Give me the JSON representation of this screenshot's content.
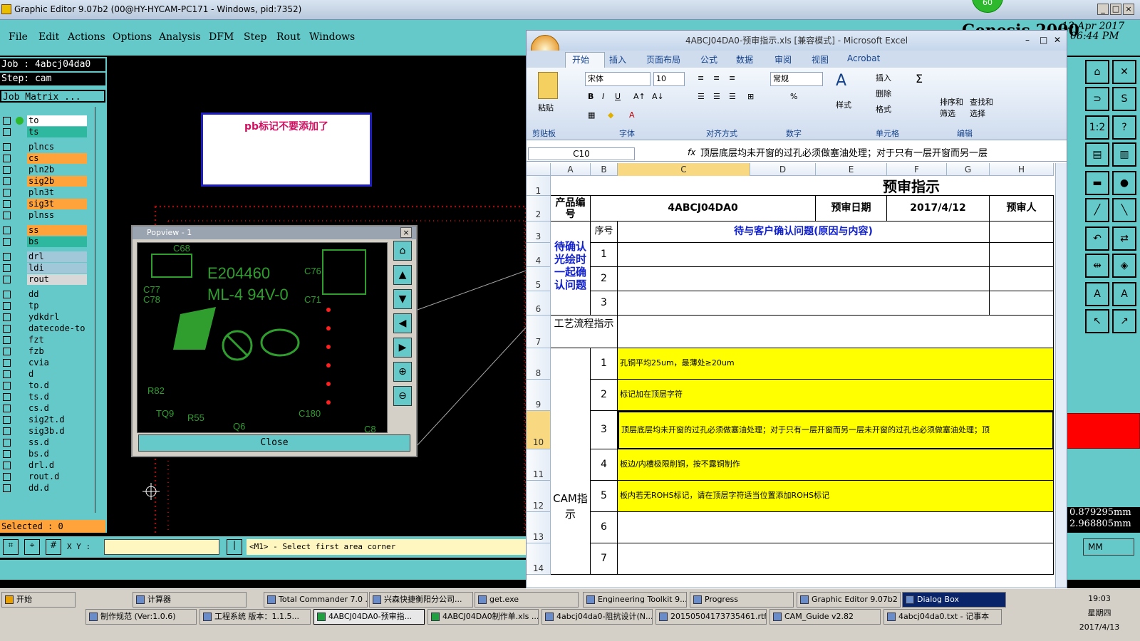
{
  "genesis": {
    "title": "Graphic Editor 9.07b2 (00@HY-HYCAM-PC171 - Windows, pid:7352)",
    "menu": [
      "File",
      "Edit",
      "Actions",
      "Options",
      "Analysis",
      "DFM",
      "Step",
      "Rout",
      "Windows"
    ],
    "badge": "60",
    "logo": "Genesis 2000",
    "date": "13 Apr 2017",
    "time": "06:44 PM",
    "job_label": "Job : 4abcj04da0",
    "step_label": "Step: cam",
    "job_matrix": "Job Matrix ...",
    "layers": [
      "to",
      "ts",
      "plncs",
      "cs",
      "pln2b",
      "sig2b",
      "pln3t",
      "sig3t",
      "plnss",
      "ss",
      "bs",
      "drl",
      "ldi",
      "rout",
      "dd",
      "tp",
      "ydkdrl",
      "datecode-to",
      "fzt",
      "fzb",
      "cvia",
      "d",
      "to.d",
      "ts.d",
      "cs.d",
      "sig2t.d",
      "sig3b.d",
      "ss.d",
      "bs.d",
      "drl.d",
      "rout.d",
      "dd.d"
    ],
    "selected": "Selected : 0",
    "xy_label": "X Y :",
    "cmd_message": "<M1> - Select first area corner",
    "note_text": "pb标记不要添加了",
    "coords": [
      "0.879295mm",
      "2.968805mm"
    ],
    "units": "MM",
    "popview": {
      "title": "Popview - 1",
      "close": "Close",
      "silk": [
        "C68",
        "E204460",
        "C76",
        "ML-4 94V-0",
        "C77",
        "C78",
        "C71",
        "R82",
        "TQ9",
        "R55",
        "Q6",
        "C180",
        "C8"
      ]
    }
  },
  "excel": {
    "title": "4ABCJ04DA0-预审指示.xls  [兼容模式] - Microsoft Excel",
    "tabs": [
      "开始",
      "插入",
      "页面布局",
      "公式",
      "数据",
      "审阅",
      "视图",
      "Acrobat"
    ],
    "ribbon": {
      "paste": "粘贴",
      "font_name": "宋体",
      "font_size": "10",
      "number_format": "常规",
      "style": "样式",
      "insert": "插入",
      "delete": "删除",
      "format": "格式",
      "sort": "排序和",
      "sort2": "筛选",
      "find": "查找和",
      "find2": "选择",
      "groups": [
        "剪贴板",
        "字体",
        "对齐方式",
        "数字",
        "单元格",
        "编辑"
      ]
    },
    "namebox": "C10",
    "fx": "fx",
    "formula": "顶层底层均未开窗的过孔必须做塞油处理；对于只有一层开窗而另一层",
    "columns": [
      "A",
      "B",
      "C",
      "D",
      "E",
      "F",
      "G",
      "H"
    ],
    "rows": [
      "1",
      "2",
      "3",
      "4",
      "5",
      "6",
      "7",
      "8",
      "9",
      "10",
      "11",
      "12",
      "13",
      "14"
    ],
    "sheet": {
      "title": "预审指示",
      "product_label": "产品编号",
      "product_value": "4ABCJ04DA0",
      "review_date_label": "预审日期",
      "review_date_value": "2017/4/12",
      "reviewer_label": "预审人",
      "confirm_label": "待确认光绘时一起确认问题",
      "seq_label": "序号",
      "confirm_header": "待与客户确认问题(原因与内容)",
      "process_label": "工艺流程指示",
      "cam_label": "CAM指示",
      "confirm_rows": [
        "1",
        "2",
        "3"
      ],
      "cam_rows": [
        {
          "n": "1",
          "text": "孔铜平均25um，最薄处≥20um"
        },
        {
          "n": "2",
          "text": "标记加在顶层字符"
        },
        {
          "n": "3",
          "text": "顶层底层均未开窗的过孔必须做塞油处理；对于只有一层开窗而另一层未开窗的过孔也必须做塞油处理；顶"
        },
        {
          "n": "4",
          "text": "板边/内槽极限削铜，按不露铜制作"
        },
        {
          "n": "5",
          "text": "板内若无ROHS标记，请在顶层字符适当位置添加ROHS标记"
        },
        {
          "n": "6",
          "text": ""
        },
        {
          "n": "7",
          "text": ""
        }
      ]
    }
  },
  "taskbar": {
    "start": "开始",
    "row1": [
      "计算器",
      "Total Commander 7.0 ...",
      "兴森快捷衡阳分公司...",
      "get.exe",
      "Engineering Toolkit 9....",
      "Progress",
      "Graphic Editor 9.07b2 ...",
      "Dialog Box"
    ],
    "row2": [
      "制作规范 (Ver:1.0.6)",
      "工程系统  版本：1.1.5...",
      "4ABCJ04DA0-预审指...",
      "4ABCJ04DA0制作单.xls ...",
      "4abcj04da0-阻抗设计(N...",
      "20150504173735461.rtf...",
      "CAM_Guide v2.82",
      "4abcj04da0.txt - 记事本"
    ],
    "clock_time": "19:03",
    "clock_day": "星期四",
    "clock_date": "2017/4/13"
  }
}
